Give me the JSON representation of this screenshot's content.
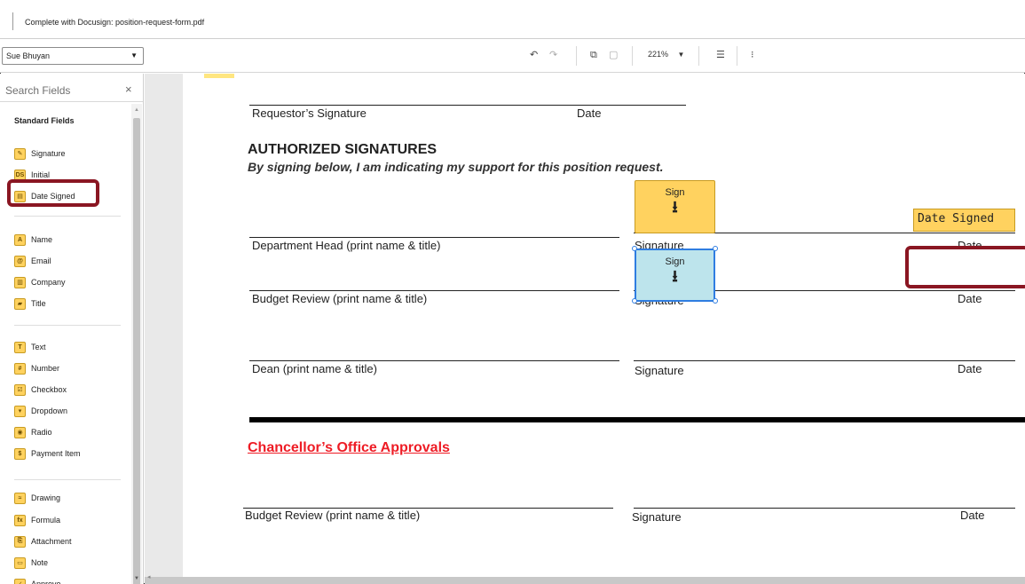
{
  "window": {
    "title": "Complete with Docusign: position-request-form.pdf"
  },
  "toolbar": {
    "signer": "Sue Bhuyan",
    "undo_icon": "undo-icon",
    "redo_icon": "redo-icon",
    "copy_icon": "copy-icon",
    "paste_icon": "paste-icon",
    "zoom": "221%",
    "comment_icon": "comment-icon",
    "fields_icon": "field-tree-icon"
  },
  "sidebar": {
    "search_placeholder": "Search Fields",
    "section_title": "Standard Fields",
    "fields": [
      {
        "label": "Signature",
        "icon": "signature-icon",
        "glyph": "✎"
      },
      {
        "label": "Initial",
        "icon": "initial-icon",
        "glyph": "DS"
      },
      {
        "label": "Date Signed",
        "icon": "date-signed-icon",
        "glyph": "▤"
      },
      {
        "label": "Name",
        "icon": "name-icon",
        "glyph": "A"
      },
      {
        "label": "Email",
        "icon": "email-icon",
        "glyph": "@"
      },
      {
        "label": "Company",
        "icon": "company-icon",
        "glyph": "▥"
      },
      {
        "label": "Title",
        "icon": "title-icon",
        "glyph": "▰"
      },
      {
        "label": "Text",
        "icon": "text-icon",
        "glyph": "T"
      },
      {
        "label": "Number",
        "icon": "number-icon",
        "glyph": "#"
      },
      {
        "label": "Checkbox",
        "icon": "checkbox-icon",
        "glyph": "☑"
      },
      {
        "label": "Dropdown",
        "icon": "dropdown-icon",
        "glyph": "▾"
      },
      {
        "label": "Radio",
        "icon": "radio-icon",
        "glyph": "◉"
      },
      {
        "label": "Payment Item",
        "icon": "payment-icon",
        "glyph": "$"
      },
      {
        "label": "Drawing",
        "icon": "drawing-icon",
        "glyph": "≈"
      },
      {
        "label": "Formula",
        "icon": "formula-icon",
        "glyph": "fx"
      },
      {
        "label": "Attachment",
        "icon": "attachment-icon",
        "glyph": "⎘"
      },
      {
        "label": "Note",
        "icon": "note-icon",
        "glyph": "▭"
      },
      {
        "label": "Approve",
        "icon": "approve-icon",
        "glyph": "✓"
      }
    ]
  },
  "document": {
    "requestor_signature": "Requestor’s Signature",
    "requestor_date": "Date",
    "authorized_heading": "AUTHORIZED SIGNATURES",
    "authorized_sub": "By signing below, I am indicating my support for this position request.",
    "dept_head": "Department Head (print name & title)",
    "signature": "Signature",
    "date": "Date",
    "budget_review": "Budget Review (print name & title)",
    "dean": "Dean (print name & title)",
    "chancellor_heading": "Chancellor’s Office Approvals",
    "budget_review_2": "Budget Review (print name & title)"
  },
  "tags": {
    "sign_label": "Sign",
    "sign_arrow": "⭳",
    "date_signed_label": "Date Signed"
  },
  "colors": {
    "tag_yellow": "#ffd25f",
    "tag_selected": "#bde4ec",
    "selection_blue": "#2f7de1",
    "highlight_red": "#8a1622",
    "heading_red": "#ee1c25"
  }
}
